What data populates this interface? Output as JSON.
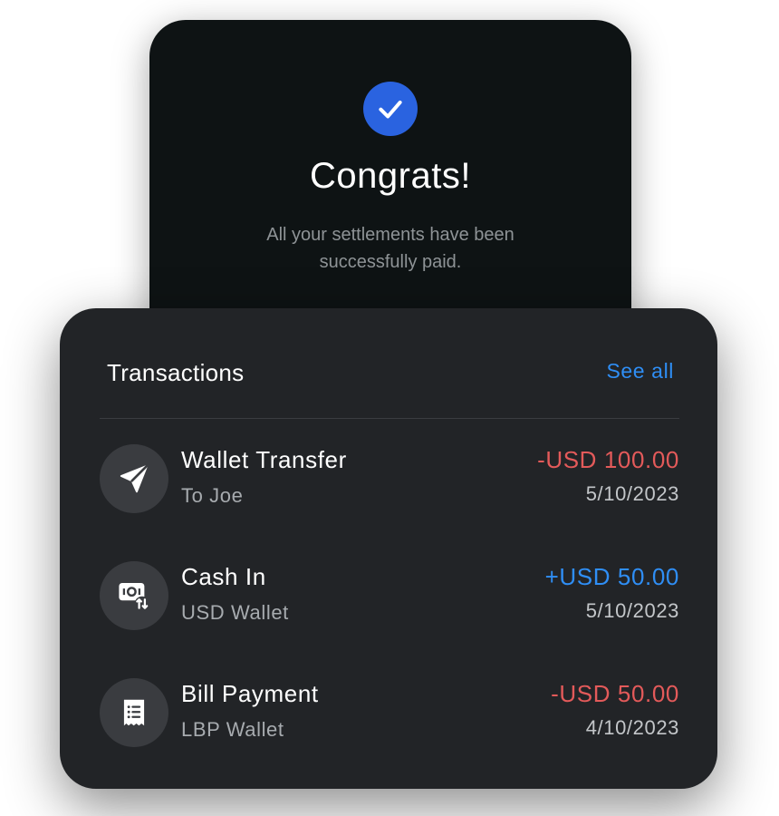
{
  "congrats": {
    "title": "Congrats!",
    "message": "All your settlements have been successfully paid.",
    "badge_icon": "check-icon",
    "badge_color": "#2a63e0"
  },
  "transactions": {
    "title": "Transactions",
    "see_all": "See all",
    "accent_color": "#2f8ef5",
    "items": [
      {
        "icon": "send-icon",
        "name": "Wallet Transfer",
        "sub": "To Joe",
        "amount": "-USD 100.00",
        "date": "5/10/2023",
        "direction": "debit"
      },
      {
        "icon": "cash-in-icon",
        "name": "Cash In",
        "sub": "USD Wallet",
        "amount": "+USD 50.00",
        "date": "5/10/2023",
        "direction": "credit"
      },
      {
        "icon": "receipt-icon",
        "name": "Bill Payment",
        "sub": "LBP Wallet",
        "amount": "-USD 50.00",
        "date": "4/10/2023",
        "direction": "debit"
      }
    ]
  },
  "colors": {
    "debit": "#e35a5a",
    "credit": "#2f8ef5"
  }
}
